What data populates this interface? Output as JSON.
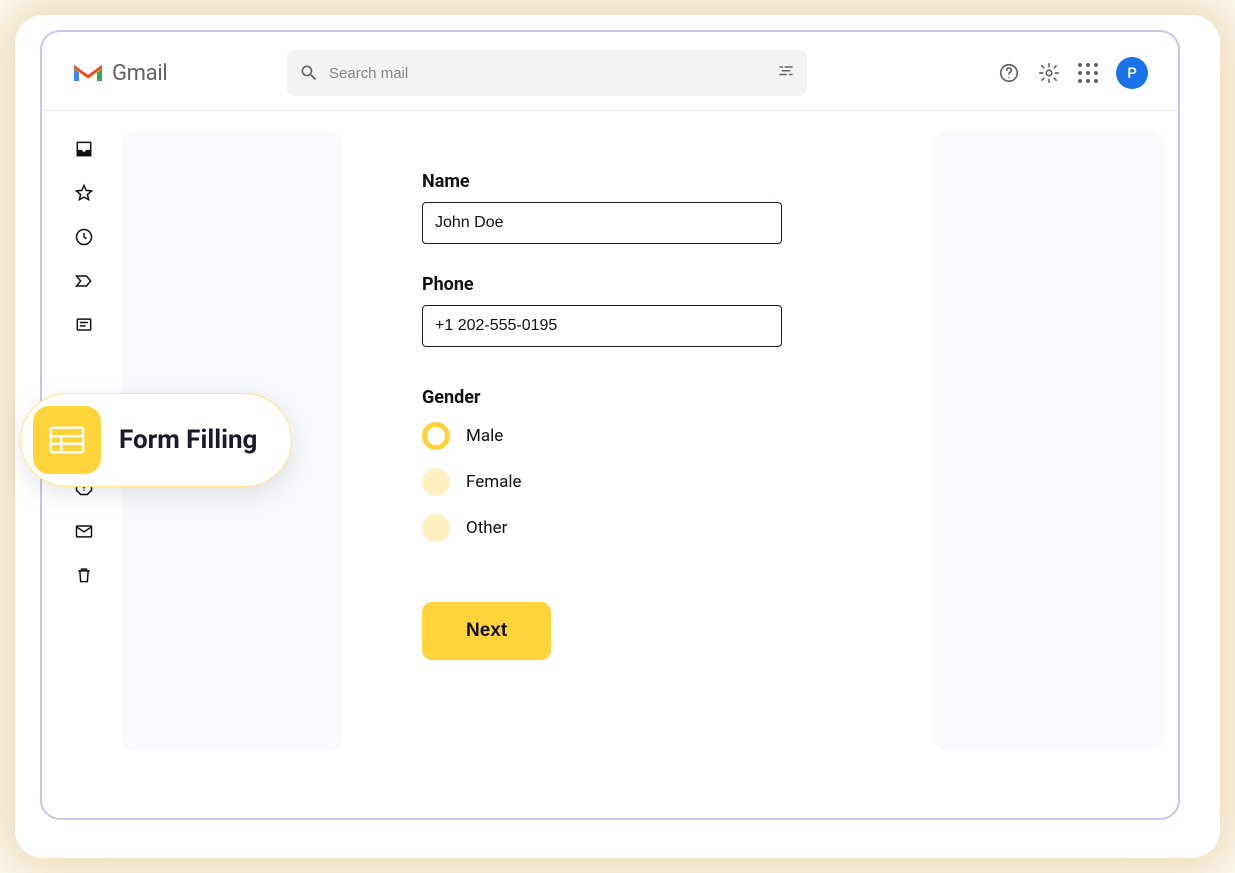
{
  "header": {
    "product_name": "Gmail",
    "search_placeholder": "Search mail",
    "avatar_initial": "P"
  },
  "badge": {
    "text": "Form Filling"
  },
  "form": {
    "name": {
      "label": "Name",
      "value": "John Doe"
    },
    "phone": {
      "label": "Phone",
      "value": "+1 202-555-0195"
    },
    "gender": {
      "label": "Gender",
      "options": [
        {
          "label": "Male",
          "selected": true
        },
        {
          "label": "Female",
          "selected": false
        },
        {
          "label": "Other",
          "selected": false
        }
      ]
    },
    "next_button": "Next"
  },
  "colors": {
    "accent_yellow": "#ffd43b",
    "accent_yellow_light": "#fff0c2",
    "avatar_blue": "#1a73e8",
    "border_dark": "#1a1a2e",
    "panel_bg": "#f8f9fc",
    "frame_border": "#c9c6e8"
  }
}
